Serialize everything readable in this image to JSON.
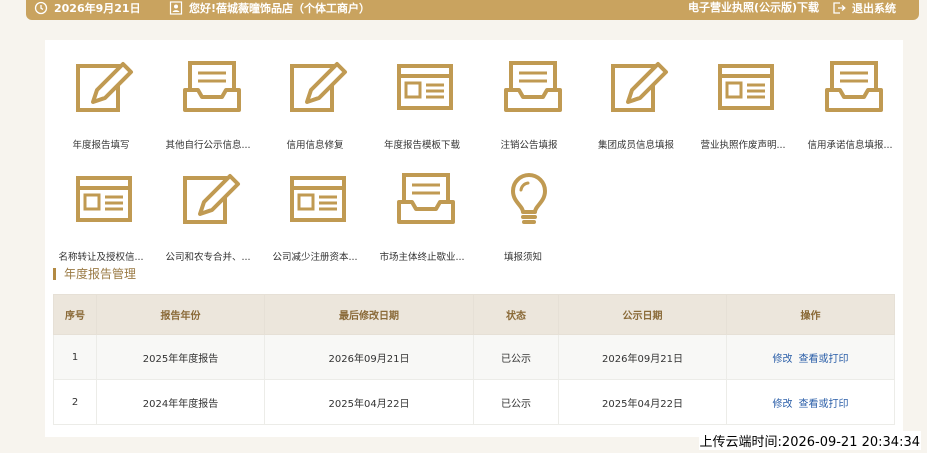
{
  "header": {
    "date": "2026年9月21日",
    "greeting": "您好!蓓城薇曈饰品店（个体工商户）",
    "license_link": "电子营业执照(公示版)下载",
    "logout": "退出系统"
  },
  "icons": [
    {
      "label": "年度报告填写",
      "icon": "edit-icon"
    },
    {
      "label": "其他自行公示信息...",
      "icon": "inbox-icon"
    },
    {
      "label": "信用信息修复",
      "icon": "edit-icon"
    },
    {
      "label": "年度报告模板下载",
      "icon": "form-icon"
    },
    {
      "label": "注销公告填报",
      "icon": "inbox-icon"
    },
    {
      "label": "集团成员信息填报",
      "icon": "edit-icon"
    },
    {
      "label": "营业执照作废声明...",
      "icon": "form-icon"
    },
    {
      "label": "信用承诺信息填报...",
      "icon": "inbox-icon"
    },
    {
      "label": "名称转让及授权信...",
      "icon": "form-icon"
    },
    {
      "label": "公司和农专合并、...",
      "icon": "edit-icon"
    },
    {
      "label": "公司减少注册资本...",
      "icon": "form-icon"
    },
    {
      "label": "市场主体终止歇业...",
      "icon": "inbox-icon"
    },
    {
      "label": "填报须知",
      "icon": "lightbulb-icon"
    }
  ],
  "section": {
    "title": "年度报告管理"
  },
  "table": {
    "headers": [
      "序号",
      "报告年份",
      "最后修改日期",
      "状态",
      "公示日期",
      "操作"
    ],
    "rows": [
      {
        "no": "1",
        "year": "2025年年度报告",
        "modified": "2026年09月21日",
        "status": "已公示",
        "published": "2026年09月21日"
      },
      {
        "no": "2",
        "year": "2024年年度报告",
        "modified": "2025年04月22日",
        "status": "已公示",
        "published": "2025年04月22日"
      }
    ],
    "action_edit": "修改",
    "action_view": "查看或打印"
  },
  "upload_stamp": "上传云端时间:2026-09-21 20:34:34",
  "colors": {
    "gold": "#c9a35f",
    "icon_gold": "#c09a52",
    "link": "#2a5ea8"
  }
}
